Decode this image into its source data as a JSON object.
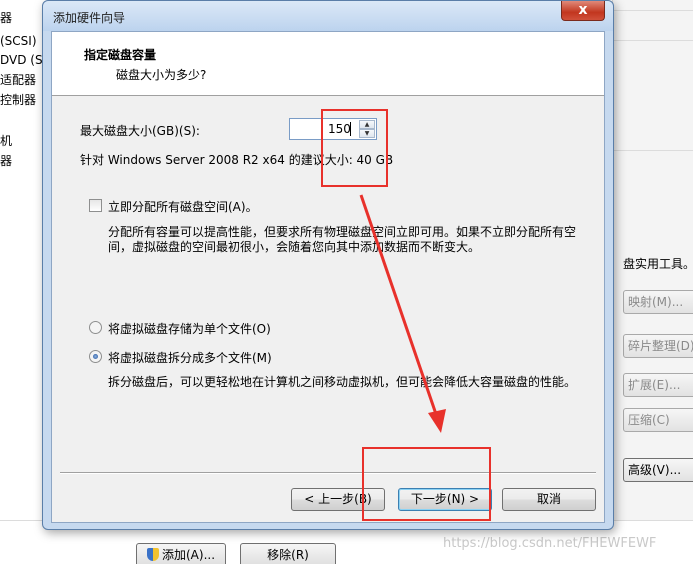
{
  "background": {
    "left_items": [
      "器",
      "(SCSI)",
      "DVD (SA",
      "适配器",
      "控制器",
      "机",
      "器"
    ],
    "right_panel": {
      "label": "盘实用工具。",
      "buttons": [
        "映射(M)...",
        "碎片整理(D)",
        "扩展(E)...",
        "压缩(C)",
        "高级(V)..."
      ]
    },
    "bottom_buttons": {
      "add": "添加(A)...",
      "remove": "移除(R)"
    },
    "watermark": "https://blog.csdn.net/FHEWFEWF"
  },
  "dialog": {
    "title": "添加硬件向导",
    "close_glyph": "x",
    "header": {
      "title": "指定磁盘容量",
      "subtitle": "磁盘大小为多少?"
    },
    "max_size_label": "最大磁盘大小(GB)(S):",
    "max_size_value": "150",
    "recommend_text": "针对 Windows Server 2008 R2 x64 的建议大小: 40 GB",
    "allocate_now": {
      "label": "立即分配所有磁盘空间(A)。",
      "checked": false,
      "description": "分配所有容量可以提高性能，但要求所有物理磁盘空间立即可用。如果不立即分配所有空间，虚拟磁盘的空间最初很小，会随着您向其中添加数据而不断变大。"
    },
    "radio_single": {
      "label": "将虚拟磁盘存储为单个文件(O)",
      "checked": false
    },
    "radio_multi": {
      "label": "将虚拟磁盘拆分成多个文件(M)",
      "checked": true,
      "description": "拆分磁盘后，可以更轻松地在计算机之间移动虚拟机，但可能会降低大容量磁盘的性能。"
    },
    "buttons": {
      "back": "< 上一步(B)",
      "next": "下一步(N) >",
      "cancel": "取消"
    }
  },
  "annotation_color": "#e8312b"
}
